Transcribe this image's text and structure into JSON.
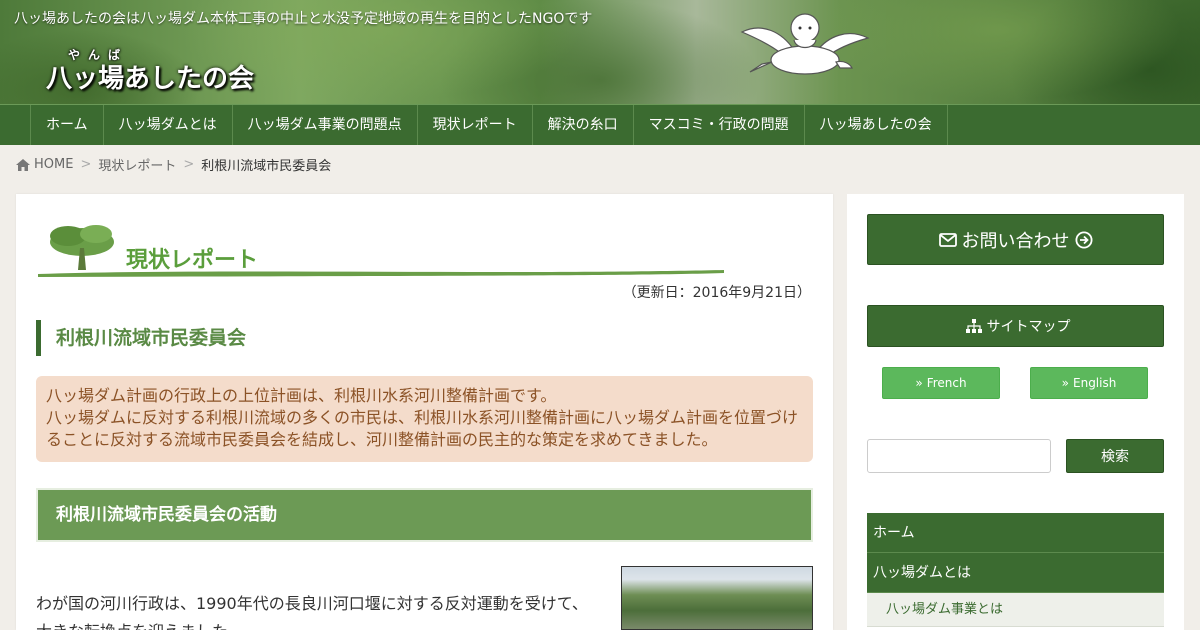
{
  "header": {
    "tagline": "八ッ場あしたの会は八ッ場ダム本体工事の中止と水没予定地域の再生を目的としたNGOです",
    "logo_ruby": "やんば",
    "logo_text": "八ッ場あしたの会"
  },
  "nav": {
    "items": [
      "ホーム",
      "八ッ場ダムとは",
      "八ッ場ダム事業の問題点",
      "現状レポート",
      "解決の糸口",
      "マスコミ・行政の問題",
      "八ッ場あしたの会"
    ]
  },
  "breadcrumb": {
    "home": "HOME",
    "separator": ">",
    "parent": "現状レポート",
    "current": "利根川流域市民委員会"
  },
  "main": {
    "category_title": "現状レポート",
    "updated": "（更新日：2016年9月21日）",
    "page_title": "利根川流域市民委員会",
    "intro_lines": [
      "八ッ場ダム計画の行政上の上位計画は、利根川水系河川整備計画です。",
      "八ッ場ダムに反対する利根川流域の多くの市民は、利根川水系河川整備計画に八ッ場ダム計画を位置づけ",
      "ることに反対する流域市民委員会を結成し、河川整備計画の民主的な策定を求めてきました。"
    ],
    "section_title": "利根川流域市民委員会の活動",
    "body_lines": [
      "わが国の河川行政は、1990年代の長良川河口堰に対する反対運動を受けて、",
      "大きな転換点を迎えました。"
    ]
  },
  "sidebar": {
    "contact_label": "お問い合わせ",
    "sitemap_label": "サイトマップ",
    "lang_french": "French",
    "lang_english": "English",
    "search_value": "",
    "search_button": "検索",
    "menu": [
      {
        "label": "ホーム",
        "type": "item"
      },
      {
        "label": "八ッ場ダムとは",
        "type": "item"
      },
      {
        "label": "八ッ場ダム事業とは",
        "type": "sub"
      }
    ]
  },
  "colors": {
    "primary_green": "#3b6b30",
    "title_green": "#5b9e3c",
    "lang_button": "#5cb85c",
    "intro_bg": "#f4dccb",
    "intro_text": "#8b5226"
  }
}
